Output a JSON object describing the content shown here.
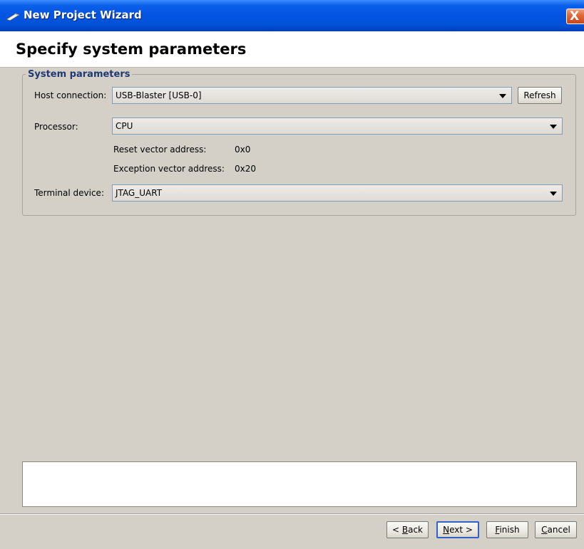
{
  "window": {
    "title": "New Project Wizard",
    "close_label": "X"
  },
  "header": {
    "title": "Specify system parameters"
  },
  "system_parameters": {
    "legend": "System parameters",
    "host_connection": {
      "label": "Host connection:",
      "value": "USB-Blaster [USB-0]",
      "refresh_label": "Refresh"
    },
    "processor": {
      "label": "Processor:",
      "value": "CPU",
      "reset_vector_label": "Reset vector address:",
      "reset_vector_value": "0x0",
      "exception_vector_label": "Exception vector address:",
      "exception_vector_value": "0x20"
    },
    "terminal_device": {
      "label": "Terminal device:",
      "value": "JTAG_UART"
    }
  },
  "message_area": {
    "text": ""
  },
  "footer": {
    "back": {
      "prefix": "< ",
      "mnemonic": "B",
      "rest": "ack"
    },
    "next": {
      "mnemonic": "N",
      "rest": "ext >"
    },
    "finish": {
      "mnemonic": "F",
      "rest": "inish"
    },
    "cancel": {
      "mnemonic": "C",
      "rest": "ancel"
    }
  },
  "colors": {
    "titlebar": "#0454e3",
    "window_bg": "#d4d0c8",
    "legend_text": "#1f3a73",
    "close_button": "#e06c3c"
  },
  "icons": {
    "title_icon": "wizard-wand-icon",
    "dropdown": "chevron-down-icon"
  }
}
